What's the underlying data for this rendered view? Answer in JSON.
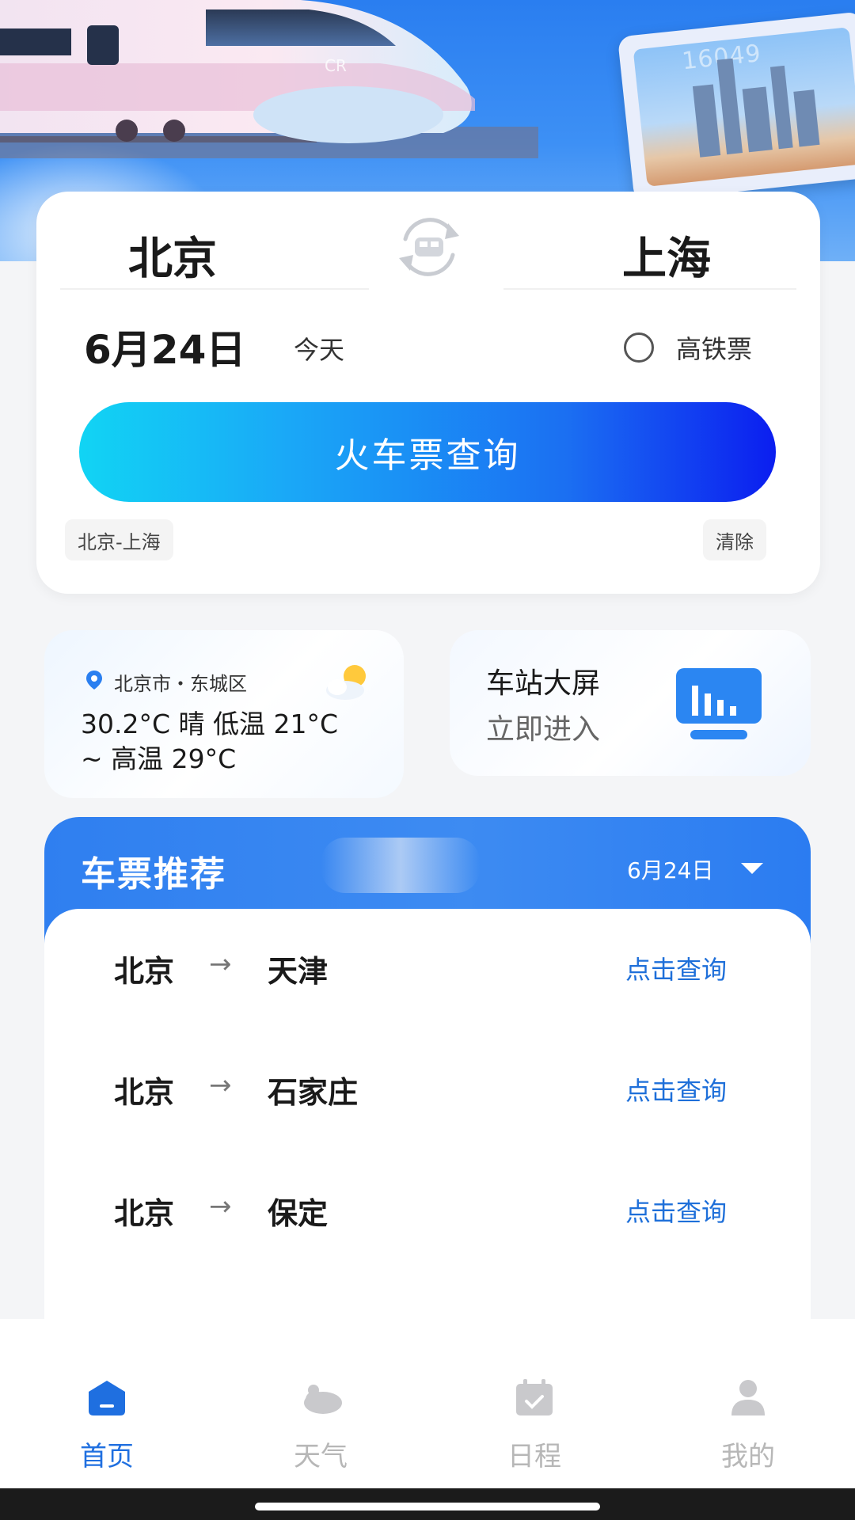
{
  "hero": {
    "ticket_number": "16049"
  },
  "search": {
    "from_city": "北京",
    "to_city": "上海",
    "date": "6月24日",
    "date_hint": "今天",
    "high_speed_label": "高铁票",
    "high_speed_checked": false,
    "search_button": "火车票查询",
    "history_chip": "北京-上海",
    "clear_chip": "清除"
  },
  "weather": {
    "location": "北京市・东城区",
    "line1": "30.2°C 晴 低温 21°C",
    "line2": "~ 高温 29°C"
  },
  "station_screen": {
    "title": "车站大屏",
    "subtitle": "立即进入"
  },
  "recommend": {
    "title": "车票推荐",
    "date": "6月24日",
    "arrow": "→",
    "rows": [
      {
        "from": "北京",
        "to": "天津",
        "action": "点击查询"
      },
      {
        "from": "北京",
        "to": "石家庄",
        "action": "点击查询"
      },
      {
        "from": "北京",
        "to": "保定",
        "action": "点击查询"
      }
    ]
  },
  "nav": {
    "items": [
      {
        "label": "首页",
        "icon": "home-icon",
        "active": true
      },
      {
        "label": "天气",
        "icon": "weather-icon",
        "active": false
      },
      {
        "label": "日程",
        "icon": "calendar-icon",
        "active": false
      },
      {
        "label": "我的",
        "icon": "profile-icon",
        "active": false
      }
    ]
  },
  "colors": {
    "accent": "#1f6fe0",
    "button_gradient_start": "#11d4f4",
    "button_gradient_end": "#0b1ef0",
    "header_blue": "#2f7ff0"
  }
}
